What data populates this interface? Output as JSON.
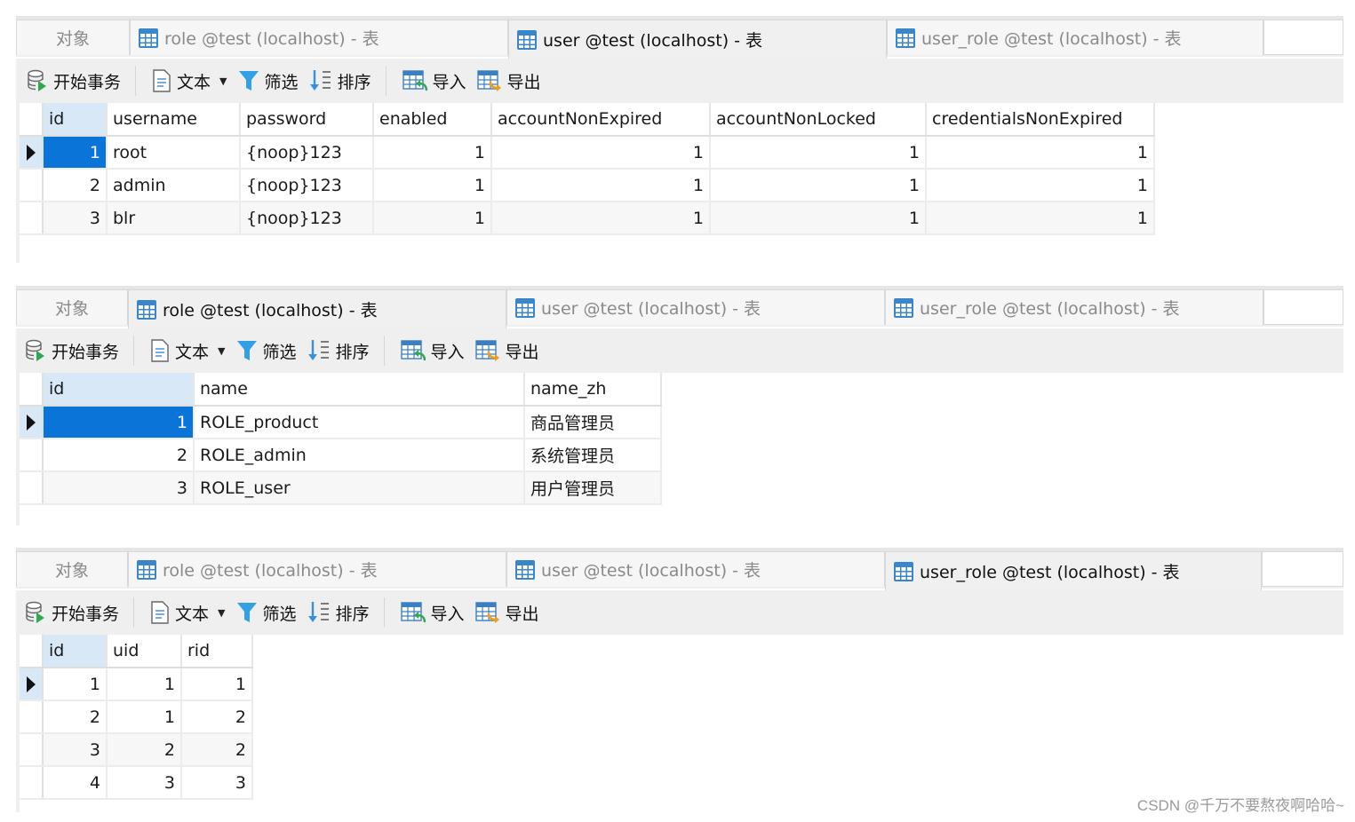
{
  "tab_labels": {
    "objects": "对象",
    "role": "role @test (localhost) - 表",
    "user": "user @test (localhost) - 表",
    "user_role": "user_role @test (localhost) - 表"
  },
  "toolbar": {
    "begin_transaction": "开始事务",
    "text": "文本",
    "filter": "筛选",
    "sort": "排序",
    "import": "导入",
    "export": "导出"
  },
  "panels": [
    {
      "active_tab": "user",
      "table": {
        "columns": [
          "id",
          "username",
          "password",
          "enabled",
          "accountNonExpired",
          "accountNonLocked",
          "credentialsNonExpired"
        ],
        "rows": [
          [
            "1",
            "root",
            "{noop}123",
            "1",
            "1",
            "1",
            "1"
          ],
          [
            "2",
            "admin",
            "{noop}123",
            "1",
            "1",
            "1",
            "1"
          ],
          [
            "3",
            "blr",
            "{noop}123",
            "1",
            "1",
            "1",
            "1"
          ]
        ]
      }
    },
    {
      "active_tab": "role",
      "table": {
        "columns": [
          "id",
          "name",
          "name_zh"
        ],
        "rows": [
          [
            "1",
            "ROLE_product",
            "商品管理员"
          ],
          [
            "2",
            "ROLE_admin",
            "系统管理员"
          ],
          [
            "3",
            "ROLE_user",
            "用户管理员"
          ]
        ]
      }
    },
    {
      "active_tab": "user_role",
      "table": {
        "columns": [
          "id",
          "uid",
          "rid"
        ],
        "rows": [
          [
            "1",
            "1",
            "1"
          ],
          [
            "2",
            "1",
            "2"
          ],
          [
            "3",
            "2",
            "2"
          ],
          [
            "4",
            "3",
            "3"
          ]
        ]
      }
    }
  ],
  "selected_row_index": 0,
  "colors": {
    "selection": "#0a74d8",
    "header_id": "#d9e8f6",
    "table_icon": "#3a86c8"
  },
  "watermark": "CSDN @千万不要熬夜啊哈哈~"
}
